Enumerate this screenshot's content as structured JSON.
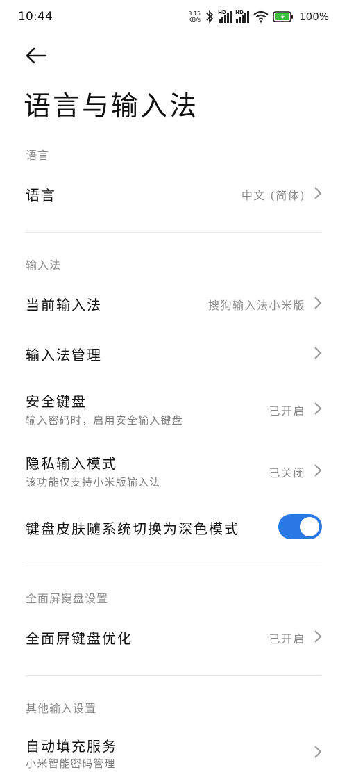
{
  "status_bar": {
    "time": "10:44",
    "net_speed_value": "3.15",
    "net_speed_unit": "KB/s",
    "hd_label": "HD",
    "battery": "100%"
  },
  "header": {
    "title": "语言与输入法"
  },
  "sections": {
    "language": {
      "header": "语言",
      "rows": [
        {
          "title": "语言",
          "value": "中文 (简体)"
        }
      ]
    },
    "input": {
      "header": "输入法",
      "rows": [
        {
          "title": "当前输入法",
          "value": "搜狗输入法小米版"
        },
        {
          "title": "输入法管理"
        },
        {
          "title": "安全键盘",
          "subtitle": "输入密码时，启用安全输入键盘",
          "value": "已开启"
        },
        {
          "title": "隐私输入模式",
          "subtitle": "该功能仅支持小米版输入法",
          "value": "已关闭"
        },
        {
          "title": "键盘皮肤随系统切换为深色模式",
          "toggle": true
        }
      ]
    },
    "fullscreen": {
      "header": "全面屏键盘设置",
      "rows": [
        {
          "title": "全面屏键盘优化",
          "value": "已开启"
        }
      ]
    },
    "other": {
      "header": "其他输入设置",
      "rows": [
        {
          "title": "自动填充服务",
          "subtitle": "小米智能密码管理"
        }
      ]
    }
  },
  "colors": {
    "accent": "#2a78e4",
    "secondary_text": "#8a8a8a"
  }
}
